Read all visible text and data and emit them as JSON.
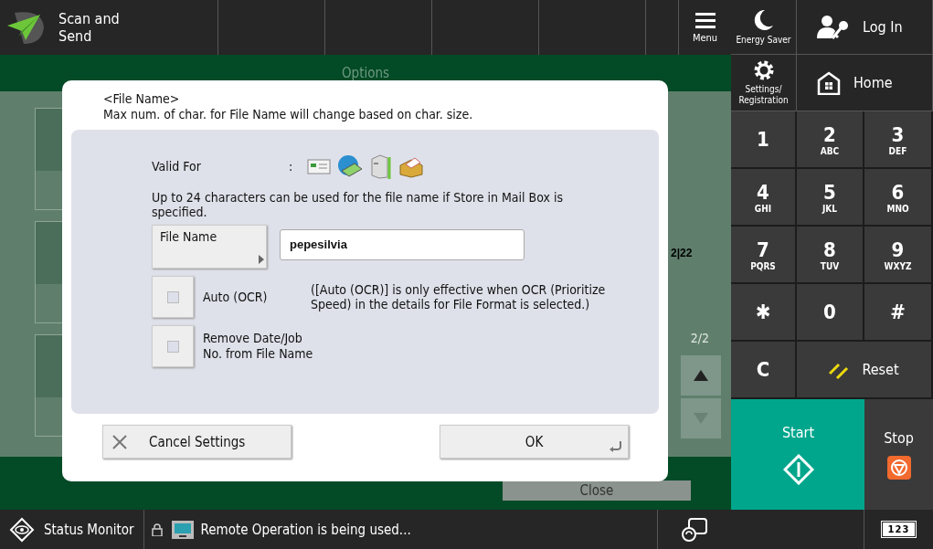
{
  "header": {
    "title": "Scan and\nSend",
    "menu": "Menu"
  },
  "background": {
    "title": "Options",
    "page": "2/2",
    "overlay_text": "2|22",
    "close": "Close"
  },
  "dialog": {
    "title": "<File Name>",
    "note": "Max num. of char. for File Name will change based on char. size.",
    "valid_for_label": "Valid For",
    "valid_for_separator": ":",
    "info": "Up to 24 characters can be used for the file name if Store in Mail Box is specified.",
    "file_name_button": "File Name",
    "file_name_value": "pepesilvia",
    "options": [
      {
        "label": "Auto (OCR)",
        "checked": false,
        "note": "([Auto (OCR)] is only effective when OCR (Prioritize Speed) in the details for File Format is selected.)"
      },
      {
        "label": "Remove Date/Job\nNo. from File Name",
        "checked": false
      }
    ],
    "cancel": "Cancel Settings",
    "ok": "OK"
  },
  "side": {
    "energy_saver": "Energy Saver",
    "log_in": "Log In",
    "settings": "Settings/\nRegistration",
    "home": "Home",
    "keys": [
      {
        "main": "1"
      },
      {
        "main": "2",
        "sub": "ABC"
      },
      {
        "main": "3",
        "sub": "DEF"
      },
      {
        "main": "4",
        "sub": "GHI"
      },
      {
        "main": "5",
        "sub": "JKL"
      },
      {
        "main": "6",
        "sub": "MNO"
      },
      {
        "main": "7",
        "sub": "PQRS"
      },
      {
        "main": "8",
        "sub": "TUV"
      },
      {
        "main": "9",
        "sub": "WXYZ"
      },
      {
        "main": "✱"
      },
      {
        "main": "0"
      },
      {
        "main": "#"
      }
    ],
    "clear": "C",
    "reset": "Reset",
    "start": "Start",
    "stop": "Stop",
    "keypad_mode": "123"
  },
  "status_bar": {
    "status_monitor": "Status Monitor",
    "message": "Remote Operation is being used..."
  }
}
